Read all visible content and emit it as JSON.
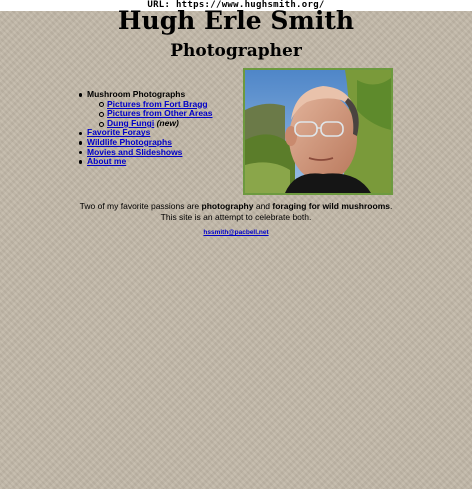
{
  "browser": {
    "url_line": "URL: https://www.hughsmith.org/"
  },
  "header": {
    "title": "Hugh Erle Smith",
    "subtitle": "Photographer"
  },
  "nav": {
    "mushroom_heading": "Mushroom Photographs",
    "fort_bragg": "Pictures from Fort Bragg",
    "other_areas": "Pictures from Other Areas",
    "dung_fungi": "Dung Fungi",
    "new_tag": "(new)",
    "forays": "Favorite Forays",
    "wildlife": "Wildlife Photographs",
    "movies": "Movies and Slideshows",
    "about": "About me"
  },
  "intro": {
    "part1": "Two of my favorite passions are ",
    "bold1": "photography",
    "part2": " and ",
    "bold2": "foraging for wild mushrooms",
    "part3": ".",
    "line2": "This site is an attempt to celebrate both."
  },
  "contact": {
    "email": "hssmith@pacbell.net"
  },
  "colors": {
    "background": "#c2b8a8",
    "link": "#0000c8",
    "photo_border": "#6d9a3f"
  },
  "icons": {
    "bullet_disc": "disc-bullet-icon",
    "bullet_circle": "circle-bullet-icon"
  }
}
